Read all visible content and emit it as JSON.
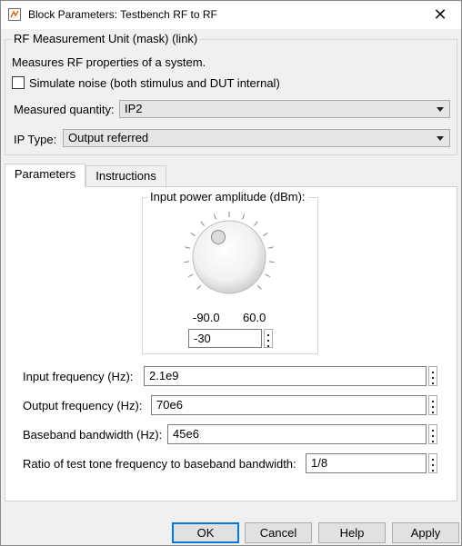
{
  "window": {
    "title": "Block Parameters: Testbench RF to RF"
  },
  "group": {
    "legend": "RF Measurement Unit (mask) (link)",
    "description": "Measures RF properties of a system.",
    "simulate_noise_label": "Simulate noise (both stimulus and DUT internal)",
    "simulate_noise_checked": false,
    "measured_quantity_label": "Measured quantity:",
    "measured_quantity_value": "IP2",
    "ip_type_label": "IP Type:",
    "ip_type_value": "Output referred"
  },
  "tabs": [
    {
      "label": "Parameters",
      "active": true
    },
    {
      "label": "Instructions",
      "active": false
    }
  ],
  "knob": {
    "label": "Input power amplitude (dBm):",
    "min": "-90.0",
    "max": "60.0",
    "value": "-30"
  },
  "fields": [
    {
      "label": "Input frequency (Hz):",
      "value": "2.1e9"
    },
    {
      "label": "Output frequency (Hz):",
      "value": "70e6"
    },
    {
      "label": "Baseband bandwidth (Hz):",
      "value": "45e6"
    },
    {
      "label": "Ratio of test tone frequency to baseband bandwidth:",
      "value": "1/8"
    }
  ],
  "buttons": {
    "ok": "OK",
    "cancel": "Cancel",
    "help": "Help",
    "apply": "Apply"
  },
  "colors": {
    "accent": "#0078d7",
    "background": "#f0f0f0",
    "panel": "#ffffff"
  }
}
